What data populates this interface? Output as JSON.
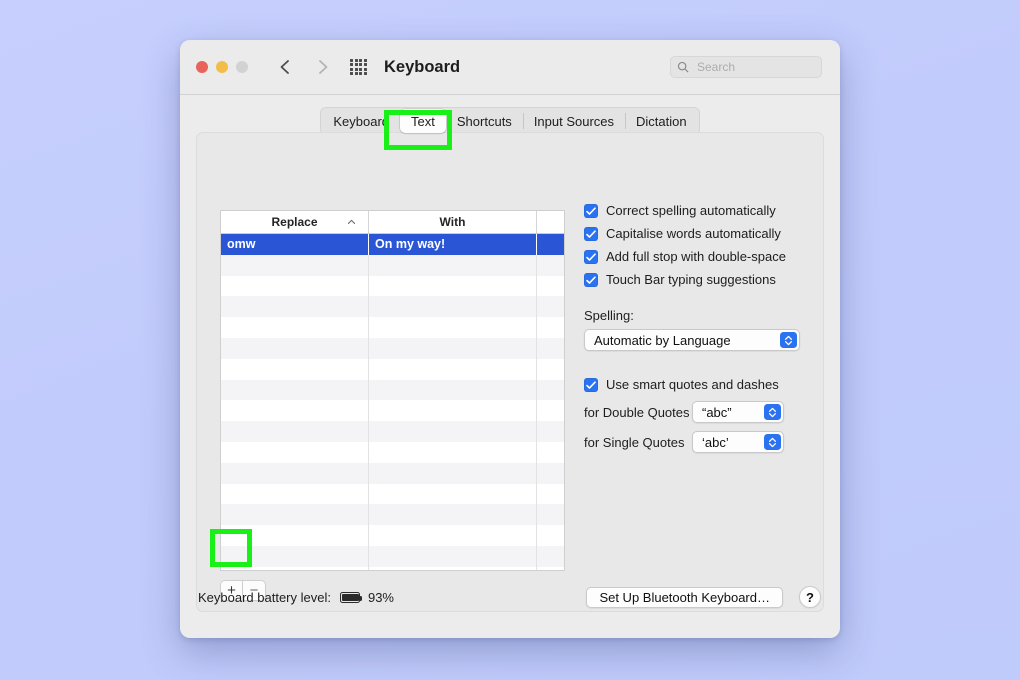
{
  "window": {
    "title": "Keyboard",
    "traffic_lights": [
      "close",
      "minimize",
      "zoom"
    ],
    "nav": {
      "back": "back-arrow",
      "forward": "forward-arrow",
      "show_all": "grid-icon"
    },
    "search": {
      "placeholder": "Search",
      "value": "",
      "icon": "search-icon"
    }
  },
  "tabs": [
    {
      "label": "Keyboard",
      "active": false
    },
    {
      "label": "Text",
      "active": true
    },
    {
      "label": "Shortcuts",
      "active": false
    },
    {
      "label": "Input Sources",
      "active": false
    },
    {
      "label": "Dictation",
      "active": false
    }
  ],
  "table": {
    "columns": [
      "Replace",
      "With",
      ""
    ],
    "sort_column": "Replace",
    "sort_direction": "ascending",
    "sort_icon": "chevron-up-icon",
    "rows": [
      {
        "replace": "omw",
        "with": "On my way!",
        "selected": true
      }
    ],
    "empty_row_count": 15,
    "add_button": "+",
    "remove_button": "−"
  },
  "options": {
    "checkboxes": [
      {
        "label": "Correct spelling automatically",
        "checked": true
      },
      {
        "label": "Capitalise words automatically",
        "checked": true
      },
      {
        "label": "Add full stop with double-space",
        "checked": true
      },
      {
        "label": "Touch Bar typing suggestions",
        "checked": true
      }
    ],
    "spelling_label": "Spelling:",
    "spelling_value": "Automatic by Language",
    "smart_quotes": {
      "label": "Use smart quotes and dashes",
      "checked": true
    },
    "double_quotes_label": "for Double Quotes",
    "double_quotes_value": "“abc”",
    "single_quotes_label": "for Single Quotes",
    "single_quotes_value": "‘abc’"
  },
  "bottom": {
    "battery_label": "Keyboard battery level:",
    "battery_value": "93%",
    "battery_icon": "battery-icon",
    "setup_button": "Set Up Bluetooth Keyboard…",
    "help_button": "?"
  },
  "annotations": {
    "color": "#18f018",
    "highlighted": [
      "text-tab",
      "add-replacement-button"
    ]
  }
}
